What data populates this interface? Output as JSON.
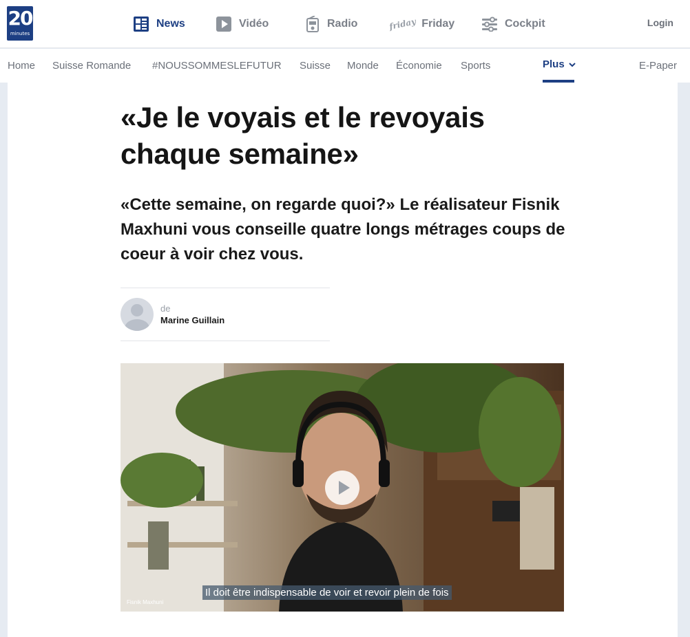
{
  "logo": {
    "number": "20",
    "word": "minutes"
  },
  "main_nav": {
    "items": [
      {
        "label": "News",
        "icon": "news-grid-icon",
        "active": true
      },
      {
        "label": "Vidéo",
        "icon": "play-square-icon"
      },
      {
        "label": "Radio",
        "icon": "radio-icon"
      },
      {
        "label": "Friday",
        "icon": "friday-logo-icon",
        "glyph": "friday"
      },
      {
        "label": "Cockpit",
        "icon": "sliders-icon"
      }
    ],
    "login": "Login"
  },
  "sub_nav": {
    "items": [
      "Home",
      "Suisse Romande",
      "#NOUSSOMMESLEFUTUR",
      "Suisse",
      "Monde",
      "Économie",
      "Sports"
    ],
    "plus": "Plus",
    "epaper": "E-Paper"
  },
  "article": {
    "headline": "«Je le voyais et le revoyais chaque semaine»",
    "lead": "«Cette semaine, on regarde quoi?» Le réalisateur Fisnik Maxhuni vous conseille quatre longs métrages coups de coeur à voir chez vous.",
    "author_prefix": "de",
    "author_name": "Marine Guillain"
  },
  "video": {
    "caption": "Il doit être indispensable de voir et revoir plein de fois",
    "name_tag": "Fisnik Maxhuni"
  },
  "colors": {
    "brand": "#1d3f83",
    "nav_text": "#6b7079",
    "page_bg": "#e6ebf2"
  }
}
